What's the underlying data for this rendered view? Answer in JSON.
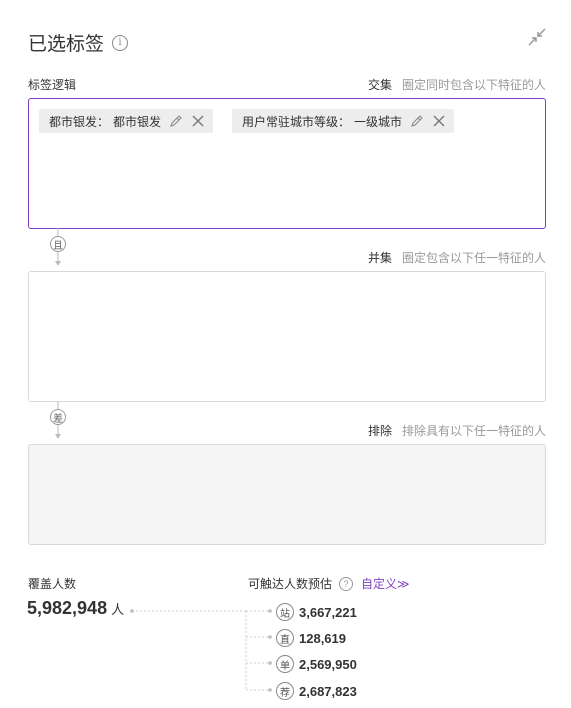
{
  "header": {
    "title": "已选标签",
    "info_icon": "info-icon",
    "collapse_icon": "collapse-arrows-icon"
  },
  "section": {
    "label": "标签逻辑"
  },
  "groups": [
    {
      "logic_name": "交集",
      "logic_hint": "圈定同时包含以下特征的人",
      "tags": [
        {
          "label": "都市银发：",
          "value": "都市银发"
        },
        {
          "label": "用户常驻城市等级：",
          "value": "一级城市"
        }
      ]
    },
    {
      "connector": "且",
      "logic_name": "并集",
      "logic_hint": "圈定包含以下任一特征的人",
      "tags": []
    },
    {
      "connector": "差",
      "logic_name": "排除",
      "logic_hint": "排除具有以下任一特征的人",
      "tags": []
    }
  ],
  "summary": {
    "cover_label": "覆盖人数",
    "cover_value": "5,982,948",
    "cover_unit": "人",
    "reach_label": "可触达人数预估",
    "custom_link": "自定义≫",
    "channels": [
      {
        "badge": "站",
        "value": "3,667,221"
      },
      {
        "badge": "直",
        "value": "128,619"
      },
      {
        "badge": "单",
        "value": "2,569,950"
      },
      {
        "badge": "荐",
        "value": "2,687,823"
      }
    ]
  },
  "colors": {
    "accent": "#7e3fbf",
    "border": "#d9d9d9",
    "tag_bg": "#ededed",
    "disabled_bg": "#f5f5f5"
  }
}
